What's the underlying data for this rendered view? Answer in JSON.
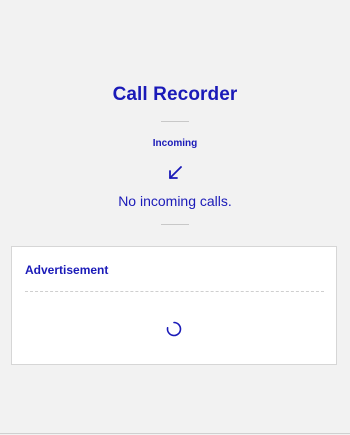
{
  "app": {
    "title": "Call Recorder"
  },
  "incoming": {
    "label": "Incoming",
    "icon": "arrow-down-left-icon",
    "empty_message": "No incoming calls."
  },
  "advertisement": {
    "title": "Advertisement",
    "loading_icon": "loading-spinner-icon"
  },
  "colors": {
    "accent": "#1a1ab8",
    "background": "#f2f2f2",
    "card": "#ffffff",
    "divider": "#c8c8c8"
  }
}
